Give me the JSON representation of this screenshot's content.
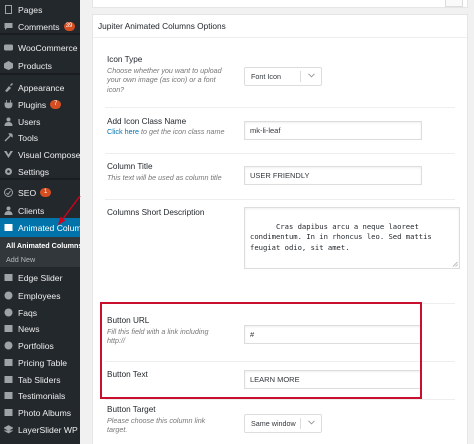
{
  "sidebar": {
    "items": [
      {
        "label": "Pages",
        "icon": "pages-icon",
        "badge": ""
      },
      {
        "label": "Comments",
        "icon": "comments-icon",
        "badge": "39"
      },
      {
        "label": "WooCommerce",
        "icon": "woocommerce-icon",
        "badge": ""
      },
      {
        "label": "Products",
        "icon": "products-icon",
        "badge": ""
      },
      {
        "label": "Appearance",
        "icon": "appearance-icon",
        "badge": ""
      },
      {
        "label": "Plugins",
        "icon": "plugins-icon",
        "badge": "7"
      },
      {
        "label": "Users",
        "icon": "users-icon",
        "badge": ""
      },
      {
        "label": "Tools",
        "icon": "tools-icon",
        "badge": ""
      },
      {
        "label": "Visual Composer",
        "icon": "visual-composer-icon",
        "badge": ""
      },
      {
        "label": "Settings",
        "icon": "settings-icon",
        "badge": ""
      },
      {
        "label": "SEO",
        "icon": "seo-icon",
        "badge": "1"
      },
      {
        "label": "Clients",
        "icon": "clients-icon",
        "badge": ""
      },
      {
        "label": "Animated Columns",
        "icon": "animated-columns-icon",
        "badge": ""
      },
      {
        "label": "Edge Slider",
        "icon": "edge-slider-icon",
        "badge": ""
      },
      {
        "label": "Employees",
        "icon": "employees-icon",
        "badge": ""
      },
      {
        "label": "Faqs",
        "icon": "faqs-icon",
        "badge": ""
      },
      {
        "label": "News",
        "icon": "news-icon",
        "badge": ""
      },
      {
        "label": "Portfolios",
        "icon": "portfolios-icon",
        "badge": ""
      },
      {
        "label": "Pricing Table",
        "icon": "pricing-table-icon",
        "badge": ""
      },
      {
        "label": "Tab Sliders",
        "icon": "tab-sliders-icon",
        "badge": ""
      },
      {
        "label": "Testimonials",
        "icon": "testimonials-icon",
        "badge": ""
      },
      {
        "label": "Photo Albums",
        "icon": "photo-albums-icon",
        "badge": ""
      },
      {
        "label": "LayerSlider WP",
        "icon": "layerslider-icon",
        "badge": ""
      }
    ],
    "submenu": [
      "All Animated Columns",
      "Add New"
    ]
  },
  "panel": {
    "title": "Jupiter Animated Columns Options",
    "icon_type": {
      "label": "Icon Type",
      "description": "Choose whether you want to upload your own image (as icon) or a font icon?",
      "value": "Font Icon"
    },
    "icon_class": {
      "label": "Add Icon Class Name",
      "link": "Click here",
      "description_rest": " to get the icon class name",
      "value": "mk-li-leaf"
    },
    "column_title": {
      "label": "Column Title",
      "description": "This text will be used as column title",
      "value": "USER FRIENDLY"
    },
    "short_description": {
      "label": "Columns Short Description",
      "value": "Cras dapibus arcu a neque laoreet condimentum. In in rhoncus leo. Sed mattis feugiat odio, sit amet."
    },
    "button_url": {
      "label": "Button URL",
      "description": "Fill this field with a link including http://",
      "value": "#"
    },
    "button_text": {
      "label": "Button Text",
      "value": "LEARN MORE"
    },
    "button_target": {
      "label": "Button Target",
      "description": "Please choose this column link target.",
      "value": "Same window"
    }
  },
  "colors": {
    "sidebar_bg": "#23282d",
    "active_bg": "#0073aa",
    "badge": "#d54e21",
    "highlight": "#c8102e"
  }
}
